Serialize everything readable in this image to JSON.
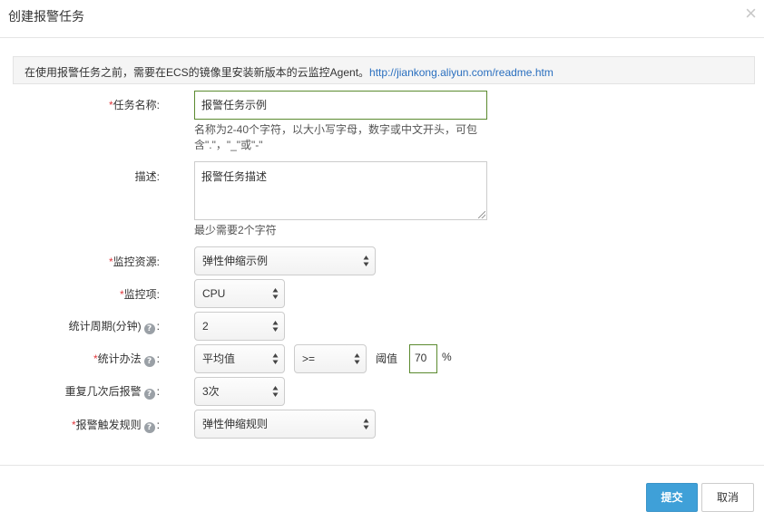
{
  "dialog": {
    "title": "创建报警任务",
    "close_icon": "close-icon"
  },
  "notice": {
    "text": "在使用报警任务之前，需要在ECS的镜像里安装新版本的云监控Agent。",
    "link": "http://jiankong.aliyun.com/readme.htm"
  },
  "form": {
    "required_mark": "*",
    "task_name": {
      "label": "任务名称:",
      "value": "报警任务示例",
      "hint": "名称为2-40个字符，以大小写字母，数字或中文开头，可包含\".\"，\"_\"或\"-\""
    },
    "description": {
      "label": "描述:",
      "value": "报警任务描述",
      "hint": "最少需要2个字符"
    },
    "resource": {
      "label": "监控资源:",
      "value": "弹性伸缩示例"
    },
    "metric": {
      "label": "监控项:",
      "value": "CPU"
    },
    "period": {
      "label": "统计周期(分钟)",
      "colon": ":",
      "value": "2"
    },
    "method": {
      "label": "统计办法",
      "colon": ":",
      "value": "平均值",
      "operator": ">=",
      "threshold_label": "阈值",
      "threshold_value": "70",
      "unit": "%"
    },
    "repeat": {
      "label": "重复几次后报警",
      "colon": ":",
      "value": "3次"
    },
    "rule": {
      "label": "报警触发规则",
      "colon": ":",
      "value": "弹性伸缩规则"
    }
  },
  "footer": {
    "submit_label": "提交",
    "cancel_label": "取消"
  },
  "colors": {
    "primary": "#3fa0d8",
    "link": "#2a6fbf",
    "required": "#e0393e",
    "focus_border": "#5b8a2f"
  },
  "icons": {
    "help": "help-icon",
    "select_arrows": "select-arrows-icon"
  }
}
